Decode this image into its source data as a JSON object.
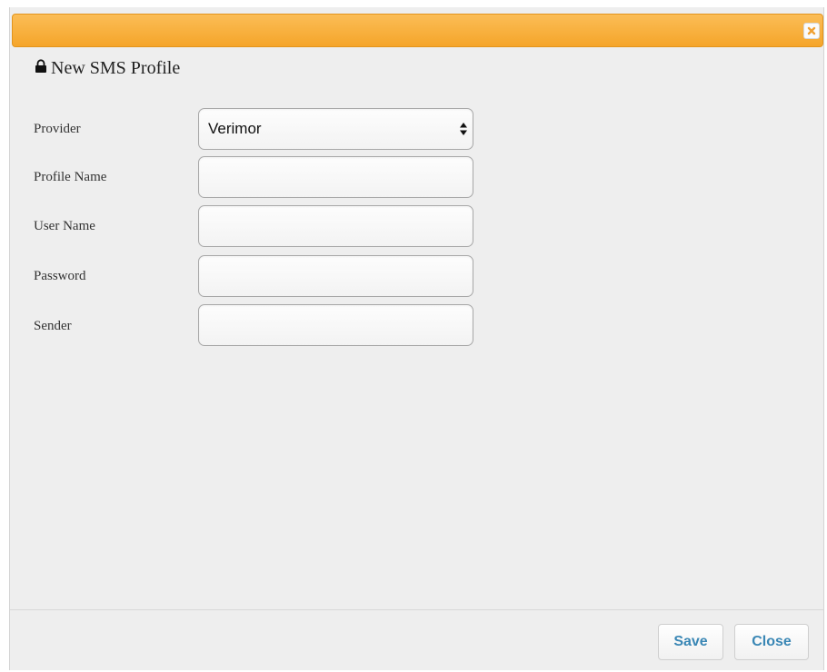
{
  "dialog": {
    "title": "New SMS Profile",
    "title_icon": "lock-icon",
    "close_icon": "close-icon",
    "accent_color": "#f7ab35"
  },
  "form": {
    "provider": {
      "label": "Provider",
      "selected_value": "Verimor"
    },
    "profile_name": {
      "label": "Profile Name",
      "value": "",
      "placeholder": ""
    },
    "user_name": {
      "label": "User Name",
      "value": "",
      "placeholder": ""
    },
    "password": {
      "label": "Password",
      "value": "",
      "placeholder": ""
    },
    "sender": {
      "label": "Sender",
      "value": "",
      "placeholder": ""
    }
  },
  "footer": {
    "save_label": "Save",
    "close_label": "Close",
    "button_text_color": "#3a87b5"
  }
}
